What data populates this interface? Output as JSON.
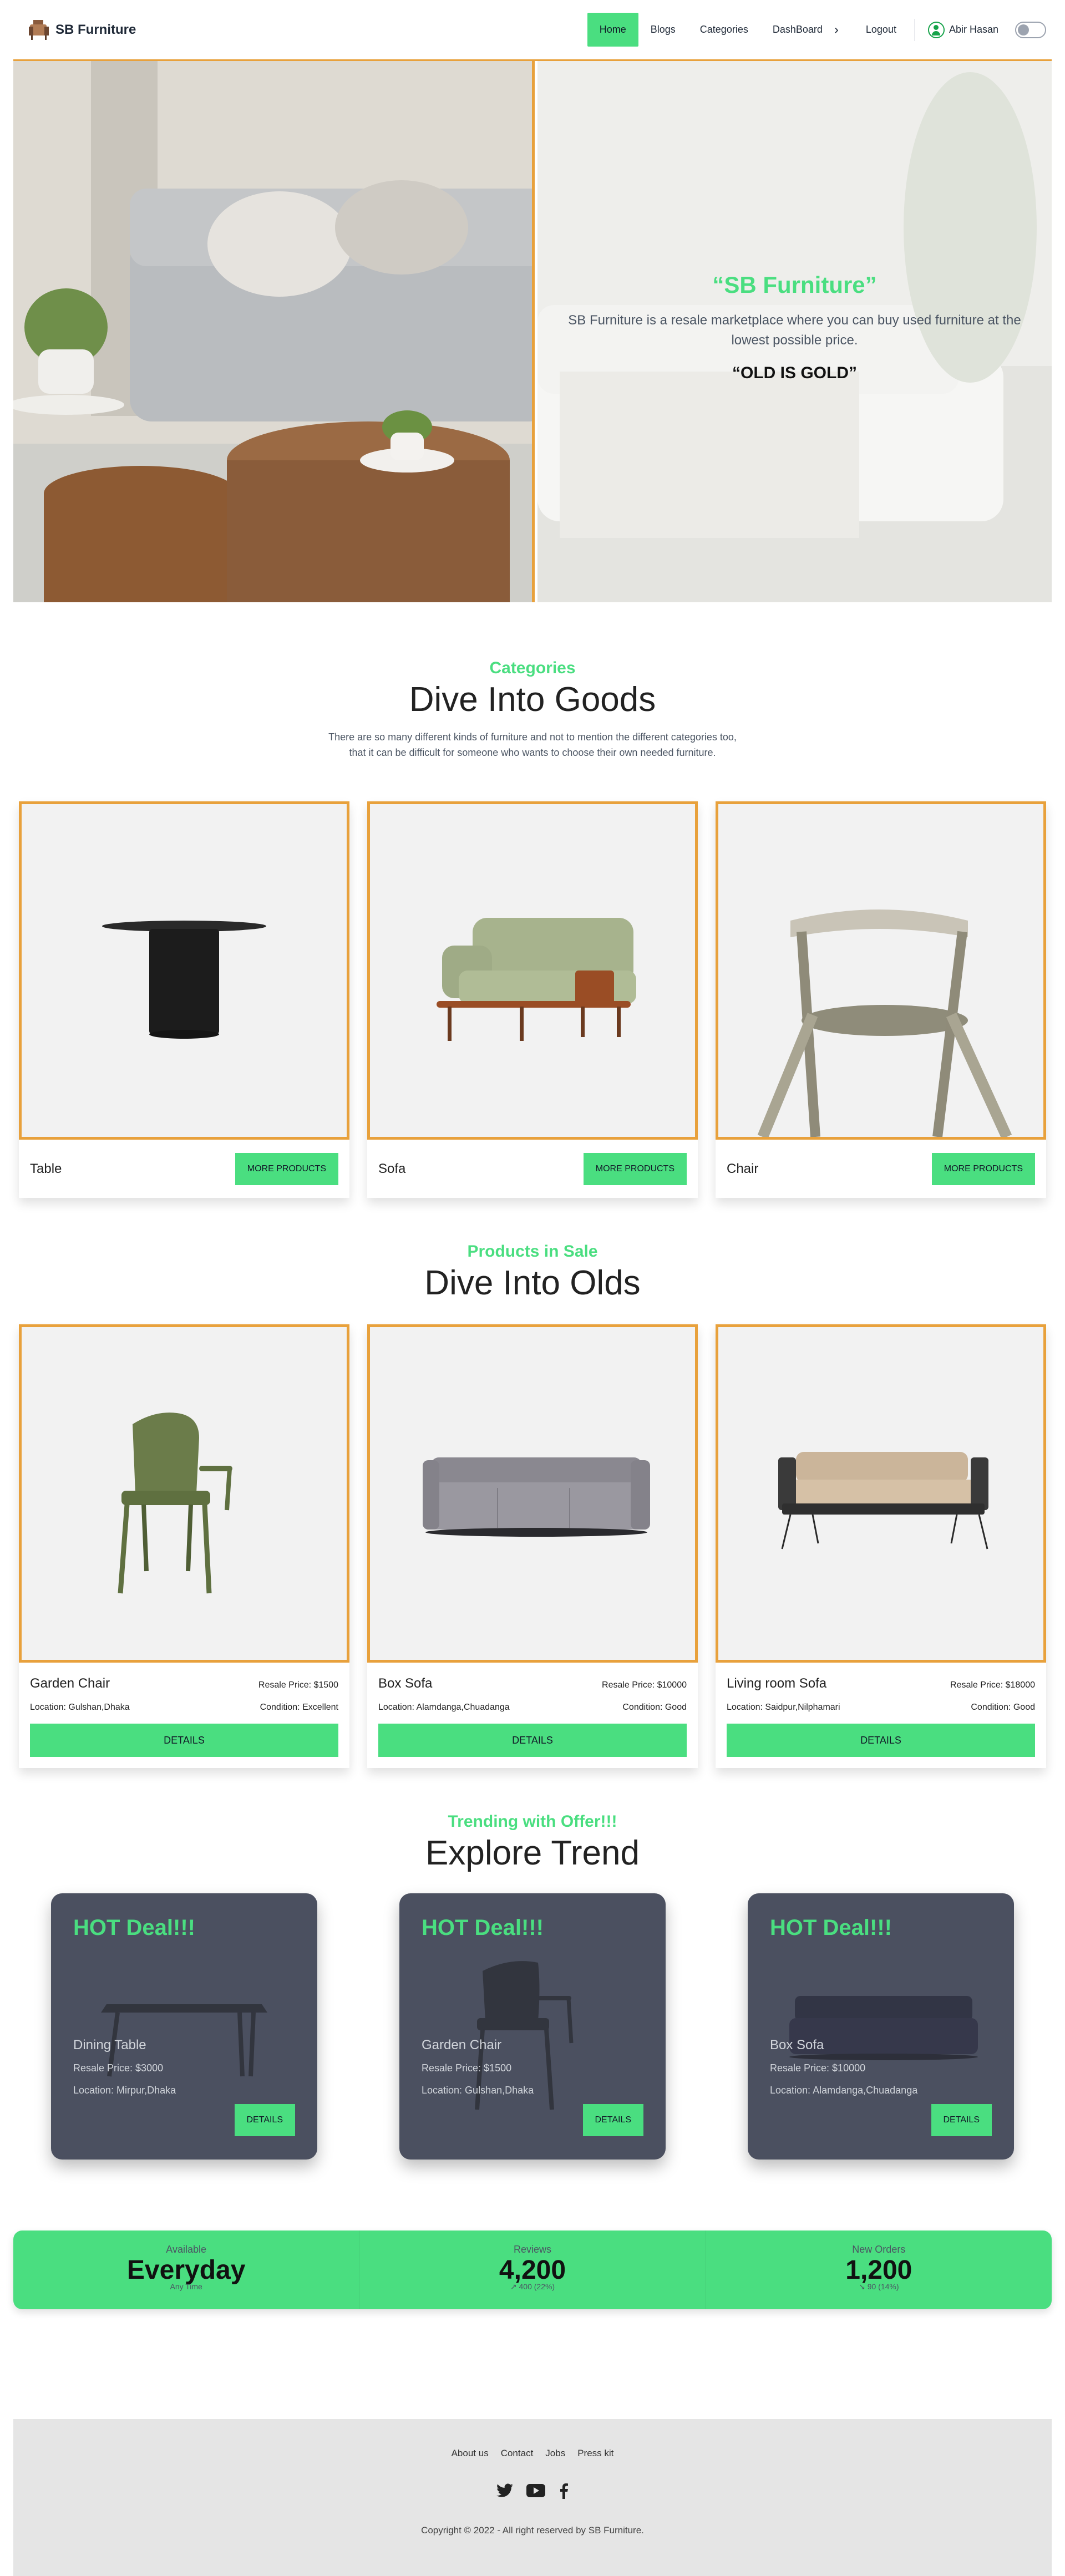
{
  "brand": {
    "name": "SB Furniture"
  },
  "nav": {
    "links": [
      "Home",
      "Blogs",
      "Categories",
      "DashBoard"
    ],
    "logout": "Logout",
    "user_name": "Abir Hasan"
  },
  "hero": {
    "title": "“SB Furniture”",
    "description": "SB Furniture is a resale marketplace where you can buy used furniture at the lowest possible price.",
    "motto": "“OLD IS GOLD”"
  },
  "categories_section": {
    "subtitle": "Categories",
    "title": "Dive Into Goods",
    "description_line1": "There are so many different kinds of furniture and not to mention the different categories too,",
    "description_line2": "that it can be difficult for someone who wants to choose their own needed furniture.",
    "button_label": "MORE PRODUCTS",
    "items": [
      {
        "name": "Table"
      },
      {
        "name": "Sofa"
      },
      {
        "name": "Chair"
      }
    ]
  },
  "products_section": {
    "subtitle": "Products in Sale",
    "title": "Dive Into Olds",
    "button_label": "DETAILS",
    "items": [
      {
        "name": "Garden Chair",
        "price": "Resale Price: $1500",
        "location": "Location: Gulshan,Dhaka",
        "condition": "Condition: Excellent"
      },
      {
        "name": "Box Sofa",
        "price": "Resale Price: $10000",
        "location": "Location: Alamdanga,Chuadanga",
        "condition": "Condition: Good"
      },
      {
        "name": "Living room Sofa",
        "price": "Resale Price: $18000",
        "location": "Location: Saidpur,Nilphamari",
        "condition": "Condition: Good"
      }
    ]
  },
  "trend_section": {
    "subtitle": "Trending with Offer!!!",
    "title": "Explore Trend",
    "hot_label": "HOT Deal!!!",
    "button_label": "DETAILS",
    "items": [
      {
        "name": "Dining Table",
        "price": "Resale Price: $3000",
        "location": "Location: Mirpur,Dhaka"
      },
      {
        "name": "Garden Chair",
        "price": "Resale Price: $1500",
        "location": "Location: Gulshan,Dhaka"
      },
      {
        "name": "Box Sofa",
        "price": "Resale Price: $10000",
        "location": "Location: Alamdanga,Chuadanga"
      }
    ]
  },
  "stats": [
    {
      "title": "Available",
      "value": "Everyday",
      "desc": "Any Time"
    },
    {
      "title": "Reviews",
      "value": "4,200",
      "desc": "↗︎ 400 (22%)"
    },
    {
      "title": "New Orders",
      "value": "1,200",
      "desc": "↘︎ 90 (14%)"
    }
  ],
  "footer": {
    "links": [
      "About us",
      "Contact",
      "Jobs",
      "Press kit"
    ],
    "copyright": "Copyright © 2022 - All right reserved by SB Furniture."
  },
  "colors": {
    "accent": "#4ade80",
    "border": "#e8a13c",
    "trend_card": "#4b5060"
  }
}
